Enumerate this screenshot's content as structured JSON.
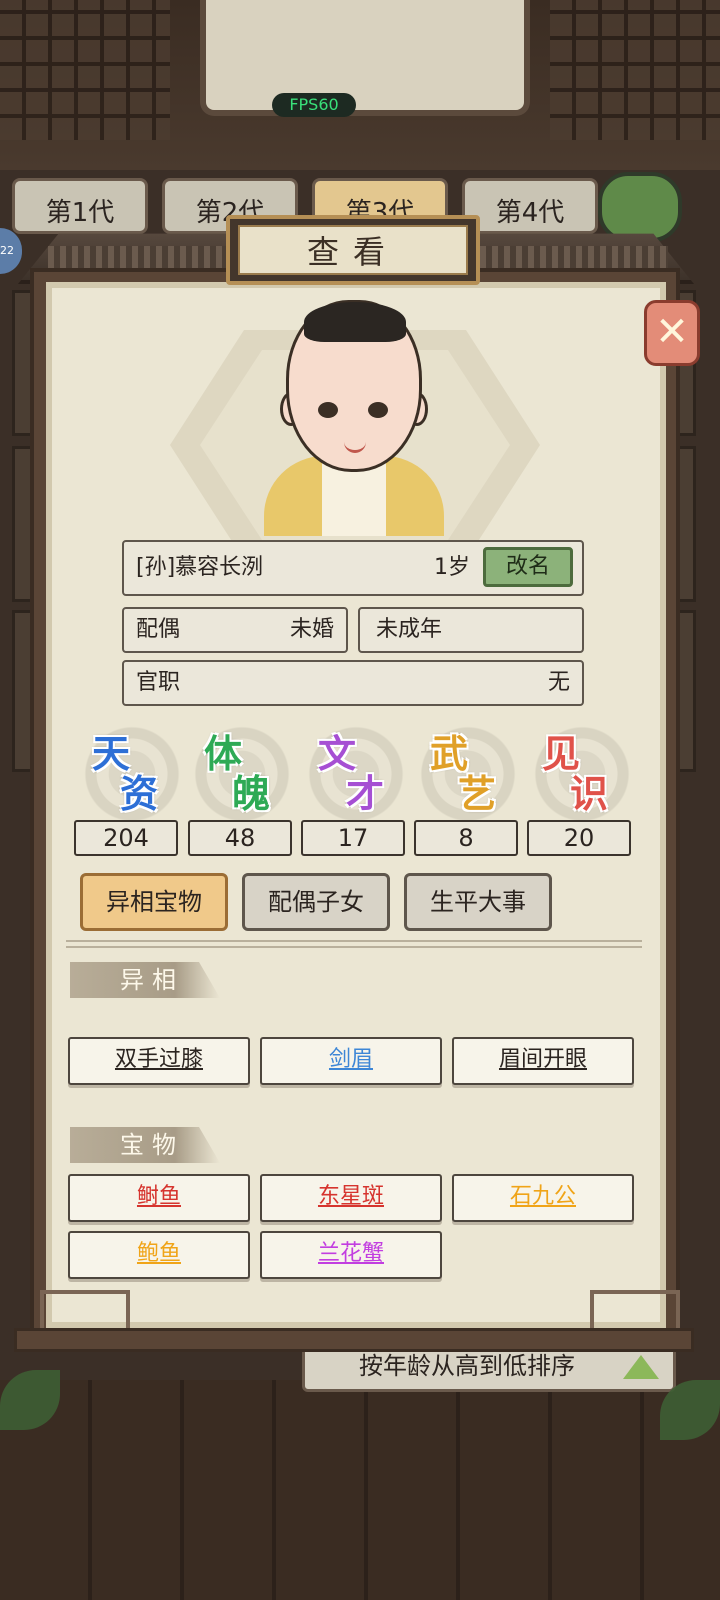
{
  "hud": {
    "fps": "FPS60",
    "side_badge": "22"
  },
  "generation_tabs": [
    {
      "label": "第1代"
    },
    {
      "label": "第2代"
    },
    {
      "label": "第3代"
    },
    {
      "label": "第4代"
    }
  ],
  "dialog": {
    "title": "查看",
    "close_icon": "close-icon"
  },
  "character": {
    "name": "[孙]慕容长洌",
    "age": "1岁",
    "rename_label": "改名",
    "spouse_label": "配偶",
    "spouse_value": "未婚",
    "status": "未成年",
    "post_label": "官职",
    "post_value": "无"
  },
  "stats": [
    {
      "name": "天资",
      "value": "204",
      "color": "#2d6fd6"
    },
    {
      "name": "体魄",
      "value": "48",
      "color": "#2eaa55"
    },
    {
      "name": "文才",
      "value": "17",
      "color": "#a64fd3"
    },
    {
      "name": "武艺",
      "value": "8",
      "color": "#e0a028"
    },
    {
      "name": "见识",
      "value": "20",
      "color": "#e0524a"
    }
  ],
  "category_tabs": [
    {
      "label": "异相宝物",
      "active": true
    },
    {
      "label": "配偶子女",
      "active": false
    },
    {
      "label": "生平大事",
      "active": false
    }
  ],
  "sections": {
    "traits_title": "异相",
    "treasures_title": "宝物"
  },
  "traits": [
    {
      "label": "双手过膝",
      "color": "#2b2420"
    },
    {
      "label": "剑眉",
      "color": "#3d86d6"
    },
    {
      "label": "眉间开眼",
      "color": "#2b2420"
    }
  ],
  "treasures": [
    {
      "label": "鲥鱼",
      "color": "#d6342e"
    },
    {
      "label": "东星斑",
      "color": "#d6342e"
    },
    {
      "label": "石九公",
      "color": "#f0a418"
    },
    {
      "label": "鲍鱼",
      "color": "#f0a418"
    },
    {
      "label": "兰花蟹",
      "color": "#c23ee0"
    }
  ],
  "sort": {
    "label": "按年龄从高到低排序"
  }
}
